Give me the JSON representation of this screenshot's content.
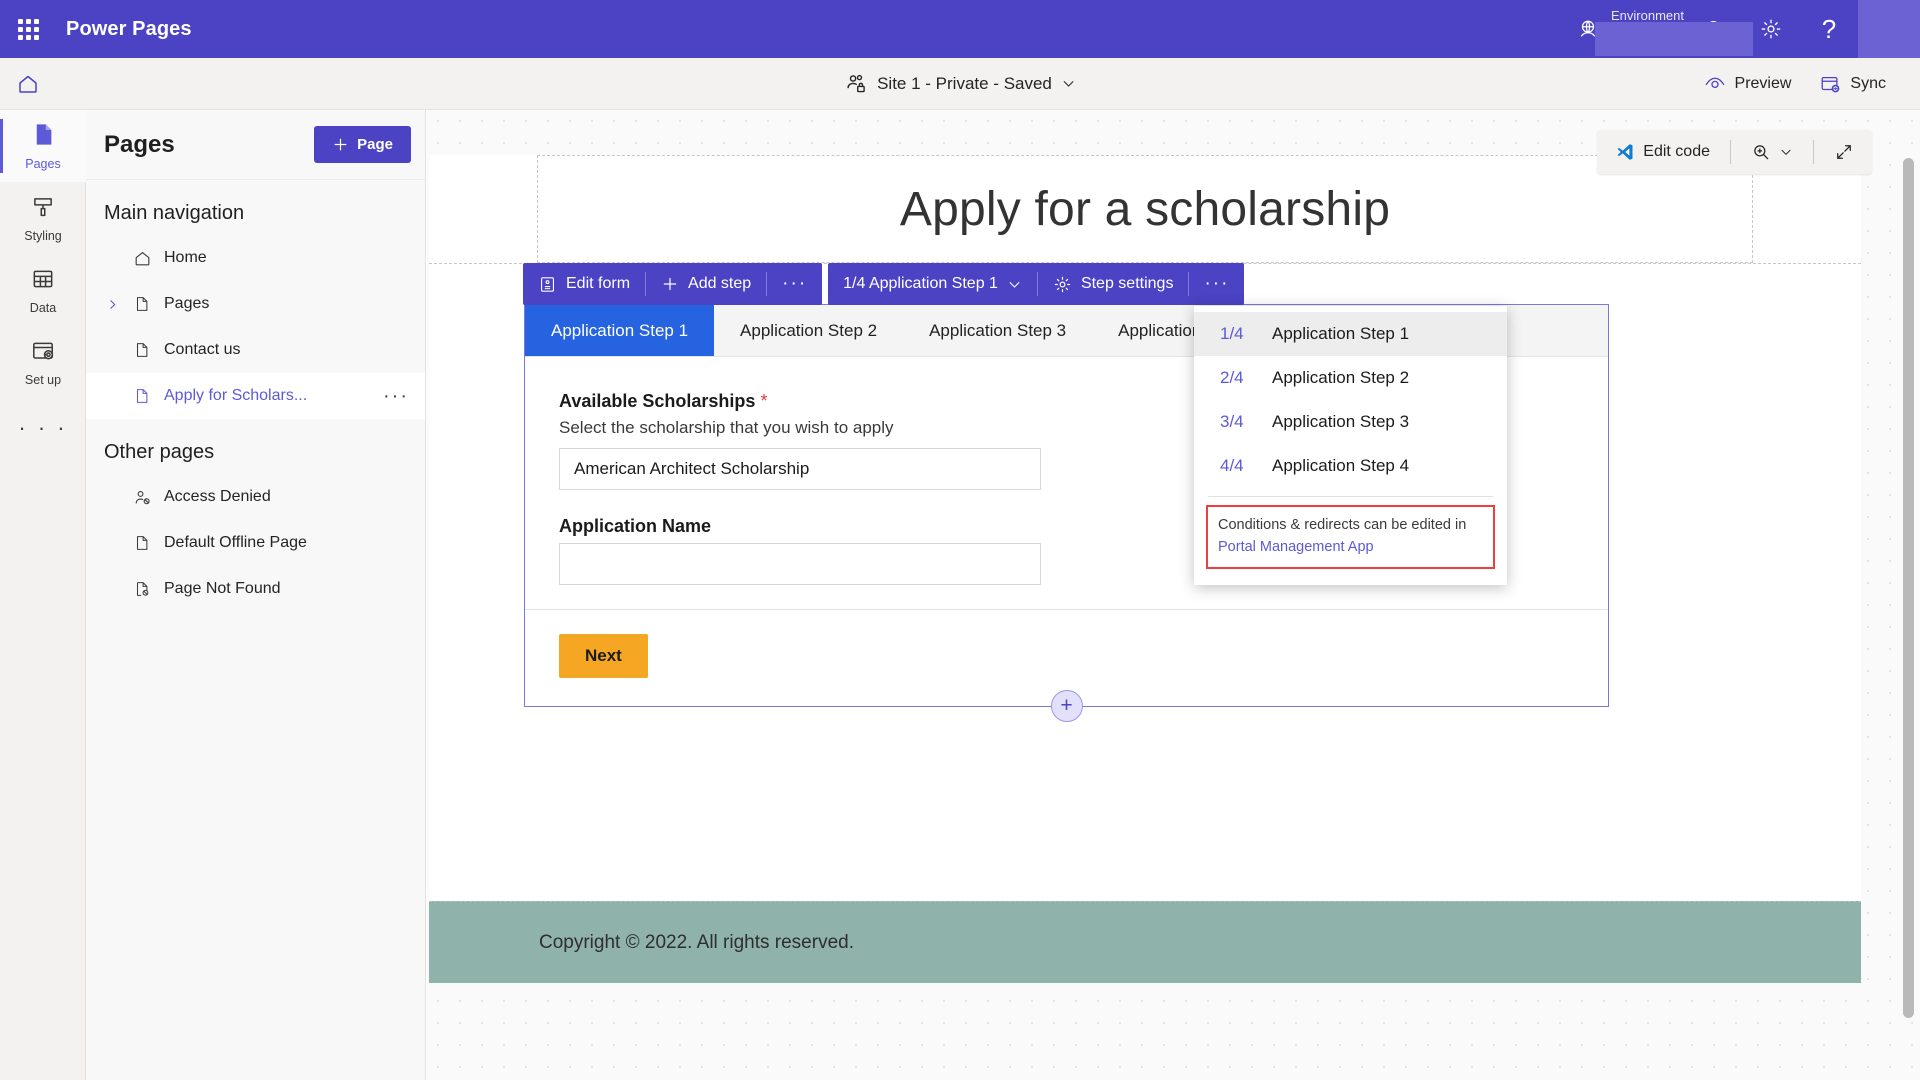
{
  "suite": {
    "waffle_name": "app-launcher",
    "title": "Power Pages",
    "environment_label": "Environment",
    "icons": {
      "globe": "globe-icon",
      "bell": "notifications-icon",
      "gear": "settings-icon",
      "help": "help-icon"
    }
  },
  "command_bar": {
    "home": "home-icon",
    "site_label": "Site 1 - Private - Saved",
    "preview_label": "Preview",
    "sync_label": "Sync"
  },
  "rail": {
    "items": [
      {
        "label": "Pages",
        "icon": "page-icon",
        "active": true
      },
      {
        "label": "Styling",
        "icon": "paint-brush-icon",
        "active": false
      },
      {
        "label": "Data",
        "icon": "table-icon",
        "active": false
      },
      {
        "label": "Set up",
        "icon": "setup-icon",
        "active": false
      }
    ],
    "more_label": "· · ·"
  },
  "panel": {
    "title": "Pages",
    "add_page_label": "Page",
    "main_nav_title": "Main navigation",
    "main_nav": [
      {
        "label": "Home",
        "icon": "home-outline-icon",
        "expandable": false,
        "selected": false
      },
      {
        "label": "Pages",
        "icon": "file-icon",
        "expandable": true,
        "selected": false
      },
      {
        "label": "Contact us",
        "icon": "file-icon",
        "expandable": false,
        "selected": false
      },
      {
        "label": "Apply for Scholars...",
        "icon": "file-icon",
        "expandable": false,
        "selected": true
      }
    ],
    "other_pages_title": "Other pages",
    "other_pages": [
      {
        "label": "Access Denied",
        "icon": "person-blocked-icon"
      },
      {
        "label": "Default Offline Page",
        "icon": "file-icon"
      },
      {
        "label": "Page Not Found",
        "icon": "file-blocked-icon"
      }
    ]
  },
  "canvas_toolbar": {
    "edit_code_label": "Edit code",
    "zoom_icon": "zoom-in-icon",
    "zoom_chevron": "chevron-down-icon",
    "fullscreen_icon": "expand-icon"
  },
  "page": {
    "title": "Apply for a scholarship",
    "footer_text": "Copyright © 2022. All rights reserved."
  },
  "form_toolbar": {
    "edit_form_label": "Edit form",
    "add_step_label": "Add step",
    "overflow_label": "· · ·",
    "step_selector_label": "1/4 Application Step 1",
    "step_settings_label": "Step settings",
    "overflow2_label": "· · ·"
  },
  "step_dropdown": {
    "items": [
      {
        "fraction": "1/4",
        "label": "Application Step 1",
        "active": true
      },
      {
        "fraction": "2/4",
        "label": "Application Step 2",
        "active": false
      },
      {
        "fraction": "3/4",
        "label": "Application Step 3",
        "active": false
      },
      {
        "fraction": "4/4",
        "label": "Application Step 4",
        "active": false
      }
    ],
    "note_text": "Conditions & redirects can be edited in",
    "note_link": "Portal Management App",
    "note_border_color": "#ef3e3e"
  },
  "form": {
    "tabs": [
      {
        "label": "Application Step 1",
        "active": true
      },
      {
        "label": "Application Step 2",
        "active": false
      },
      {
        "label": "Application Step 3",
        "active": false
      },
      {
        "label": "Application Step 4",
        "active": false
      }
    ],
    "fields": [
      {
        "label": "Available Scholarships",
        "required": true,
        "help": "Select the scholarship that you wish to apply",
        "value": "American Architect Scholarship",
        "type": "select"
      },
      {
        "label": "Application Name",
        "required": false,
        "help": "",
        "value": "",
        "type": "text"
      }
    ],
    "next_label": "Next",
    "add_section_label": "+"
  },
  "colors": {
    "brand_purple": "#4b42c4",
    "accent_purple": "#5c5ad6",
    "tab_blue": "#2563e0",
    "next_orange": "#f5a623",
    "footer_green": "#8fb3ab",
    "required_red": "#e23b3b"
  }
}
